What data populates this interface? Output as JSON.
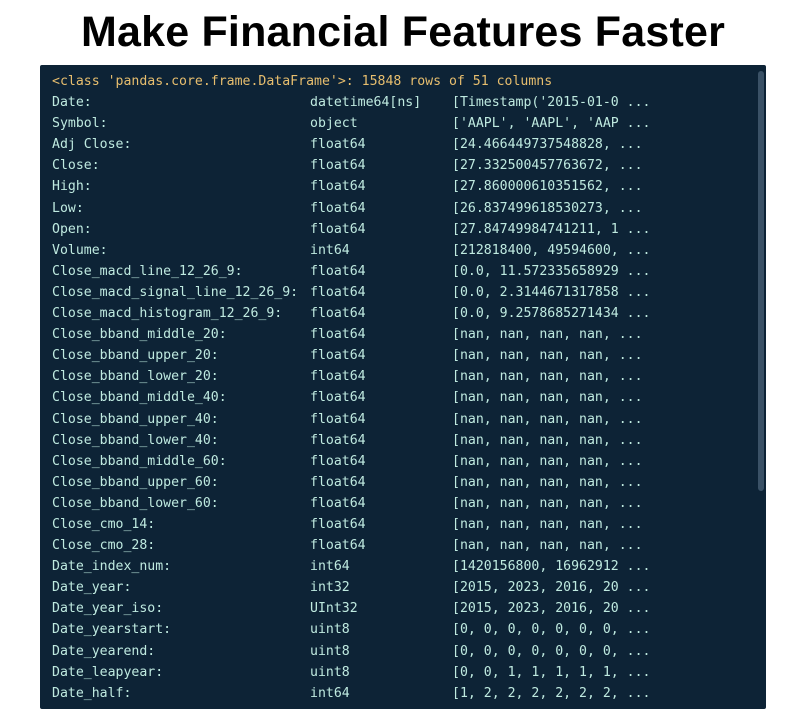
{
  "title": "Make Financial Features Faster",
  "header_line": "<class 'pandas.core.frame.DataFrame'>: 15848 rows of 51 columns",
  "colors": {
    "bg": "#0d2336",
    "text": "#bfeae0",
    "header": "#e7be6e",
    "scroll": "#3a5166"
  },
  "rows": [
    {
      "name": "Date:",
      "type": "datetime64[ns]",
      "sample": "[Timestamp('2015-01-0 ..."
    },
    {
      "name": "Symbol:",
      "type": "object",
      "sample": "['AAPL', 'AAPL', 'AAP ..."
    },
    {
      "name": "Adj Close:",
      "type": "float64",
      "sample": "[24.466449737548828,  ..."
    },
    {
      "name": "Close:",
      "type": "float64",
      "sample": "[27.332500457763672,  ..."
    },
    {
      "name": "High:",
      "type": "float64",
      "sample": "[27.860000610351562,  ..."
    },
    {
      "name": "Low:",
      "type": "float64",
      "sample": "[26.837499618530273,  ..."
    },
    {
      "name": "Open:",
      "type": "float64",
      "sample": "[27.84749984741211, 1 ..."
    },
    {
      "name": "Volume:",
      "type": "int64",
      "sample": "[212818400, 49594600, ..."
    },
    {
      "name": "Close_macd_line_12_26_9:",
      "type": "float64",
      "sample": "[0.0, 11.572335658929 ..."
    },
    {
      "name": "Close_macd_signal_line_12_26_9:",
      "type": "float64",
      "sample": "[0.0, 2.3144671317858 ..."
    },
    {
      "name": "Close_macd_histogram_12_26_9:",
      "type": "float64",
      "sample": "[0.0, 9.2578685271434 ..."
    },
    {
      "name": "Close_bband_middle_20:",
      "type": "float64",
      "sample": "[nan, nan, nan, nan,  ..."
    },
    {
      "name": "Close_bband_upper_20:",
      "type": "float64",
      "sample": "[nan, nan, nan, nan,  ..."
    },
    {
      "name": "Close_bband_lower_20:",
      "type": "float64",
      "sample": "[nan, nan, nan, nan,  ..."
    },
    {
      "name": "Close_bband_middle_40:",
      "type": "float64",
      "sample": "[nan, nan, nan, nan,  ..."
    },
    {
      "name": "Close_bband_upper_40:",
      "type": "float64",
      "sample": "[nan, nan, nan, nan,  ..."
    },
    {
      "name": "Close_bband_lower_40:",
      "type": "float64",
      "sample": "[nan, nan, nan, nan,  ..."
    },
    {
      "name": "Close_bband_middle_60:",
      "type": "float64",
      "sample": "[nan, nan, nan, nan,  ..."
    },
    {
      "name": "Close_bband_upper_60:",
      "type": "float64",
      "sample": "[nan, nan, nan, nan,  ..."
    },
    {
      "name": "Close_bband_lower_60:",
      "type": "float64",
      "sample": "[nan, nan, nan, nan,  ..."
    },
    {
      "name": "Close_cmo_14:",
      "type": "float64",
      "sample": "[nan, nan, nan, nan,  ..."
    },
    {
      "name": "Close_cmo_28:",
      "type": "float64",
      "sample": "[nan, nan, nan, nan,  ..."
    },
    {
      "name": "Date_index_num:",
      "type": "int64",
      "sample": "[1420156800, 16962912 ..."
    },
    {
      "name": "Date_year:",
      "type": "int32",
      "sample": "[2015, 2023, 2016, 20 ..."
    },
    {
      "name": "Date_year_iso:",
      "type": "UInt32",
      "sample": "[2015, 2023, 2016, 20 ..."
    },
    {
      "name": "Date_yearstart:",
      "type": "uint8",
      "sample": "[0, 0, 0, 0, 0, 0, 0, ..."
    },
    {
      "name": "Date_yearend:",
      "type": "uint8",
      "sample": "[0, 0, 0, 0, 0, 0, 0, ..."
    },
    {
      "name": "Date_leapyear:",
      "type": "uint8",
      "sample": "[0, 0, 1, 1, 1, 1, 1, ..."
    },
    {
      "name": "Date_half:",
      "type": "int64",
      "sample": "[1, 2, 2, 2, 2, 2, 2, ..."
    }
  ]
}
